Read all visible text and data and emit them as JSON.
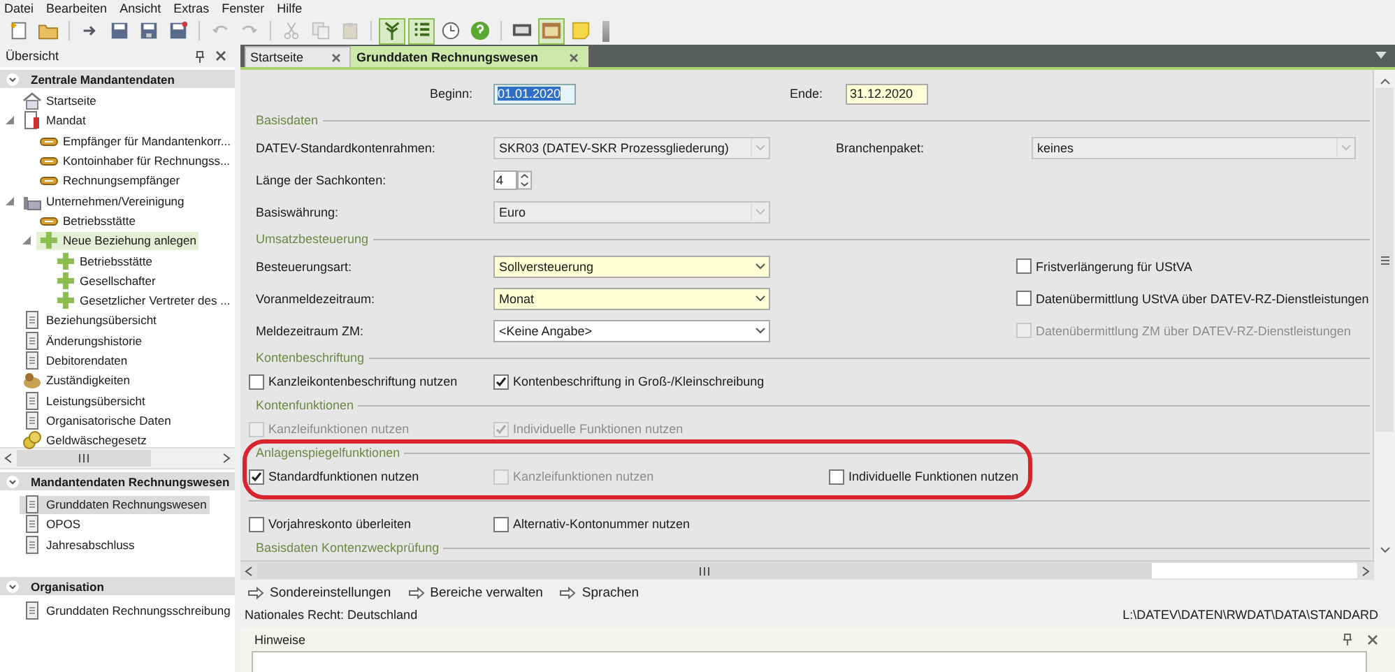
{
  "menu": [
    "Datei",
    "Bearbeiten",
    "Ansicht",
    "Extras",
    "Fenster",
    "Hilfe"
  ],
  "toolbar": [
    [
      {
        "pressed": false,
        "disabled": false
      },
      {
        "pressed": false,
        "disabled": false
      }
    ],
    [
      {
        "pressed": false,
        "disabled": false
      },
      {
        "pressed": false,
        "disabled": false
      },
      {
        "pressed": false,
        "disabled": false
      },
      {
        "pressed": false,
        "disabled": false
      }
    ],
    [
      {
        "pressed": false,
        "disabled": true
      },
      {
        "pressed": false,
        "disabled": true
      }
    ],
    [
      {
        "pressed": false,
        "disabled": true
      },
      {
        "pressed": false,
        "disabled": true
      },
      {
        "pressed": false,
        "disabled": true
      }
    ],
    [
      {
        "pressed": true,
        "disabled": false
      },
      {
        "pressed": true,
        "disabled": false
      },
      {
        "pressed": false,
        "disabled": false
      },
      {
        "pressed": false,
        "disabled": false
      }
    ],
    [
      {
        "pressed": false,
        "disabled": false
      },
      {
        "pressed": true,
        "disabled": false
      },
      {
        "pressed": false,
        "disabled": false
      }
    ]
  ],
  "sidebar": {
    "title": "Übersicht",
    "sections": [
      {
        "title": "Zentrale Mandantendaten",
        "expanded": true,
        "items": [
          {
            "label": "Startseite",
            "kind": "home",
            "selected": false
          },
          {
            "label": "Mandat",
            "kind": "record",
            "selected": false,
            "expanded": true,
            "children": [
              {
                "label": "Empfänger für Mandantenkorr...",
                "kind": "link",
                "selected": false
              },
              {
                "label": "Kontoinhaber für Rechnungss...",
                "kind": "link",
                "selected": false
              },
              {
                "label": "Rechnungsempfänger",
                "kind": "link",
                "selected": false
              }
            ]
          },
          {
            "label": "Unternehmen/Vereinigung",
            "kind": "company",
            "selected": false,
            "expanded": true,
            "children": [
              {
                "label": "Betriebsstätte",
                "kind": "link",
                "selected": false
              },
              {
                "label": "Neue Beziehung anlegen",
                "kind": "plus",
                "selected": true,
                "expanded": true,
                "children": [
                  {
                    "label": "Betriebsstätte",
                    "kind": "plus",
                    "selected": false
                  },
                  {
                    "label": "Gesellschafter",
                    "kind": "plus",
                    "selected": false
                  },
                  {
                    "label": "Gesetzlicher Vertreter des ...",
                    "kind": "plus",
                    "selected": false
                  }
                ]
              }
            ]
          },
          {
            "label": "Beziehungsübersicht",
            "kind": "page",
            "selected": false
          },
          {
            "label": "Änderungshistorie",
            "kind": "page",
            "selected": false
          },
          {
            "label": "Debitorendaten",
            "kind": "page",
            "selected": false
          },
          {
            "label": "Zuständigkeiten",
            "kind": "group",
            "selected": false
          },
          {
            "label": "Leistungsübersicht",
            "kind": "page",
            "selected": false
          },
          {
            "label": "Organisatorische Daten",
            "kind": "page",
            "selected": false
          },
          {
            "label": "Geldwäschegesetz",
            "kind": "coins",
            "selected": false
          }
        ]
      },
      {
        "title": "Mandantendaten Rechnungswesen",
        "expanded": true,
        "items": [
          {
            "label": "Grunddaten Rechnungswesen",
            "kind": "page",
            "selected": true
          },
          {
            "label": "OPOS",
            "kind": "page",
            "selected": false
          },
          {
            "label": "Jahresabschluss",
            "kind": "page",
            "selected": false
          }
        ]
      },
      {
        "title": "Organisation",
        "expanded": true,
        "items": [
          {
            "label": "Grunddaten Rechnungsschreibung",
            "kind": "page",
            "selected": false
          }
        ]
      }
    ]
  },
  "tabs": [
    {
      "label": "Startseite",
      "selected": false
    },
    {
      "label": "Grunddaten Rechnungswesen",
      "selected": true
    }
  ],
  "form": {
    "sections": [
      {
        "rows": [
          {
            "kind": "dates",
            "fields": [
              {
                "label": "Beginn:",
                "value": "01.01.2020",
                "focused": true,
                "required": false
              },
              {
                "label": "Ende:",
                "value": "31.12.2020",
                "focused": false,
                "required": true
              }
            ]
          }
        ]
      },
      {
        "title": "Basisdaten",
        "rows": [
          {
            "kind": "select",
            "label": "DATEV-Standardkontenrahmen:",
            "value": "SKR03 (DATEV-SKR Prozessgliederung)",
            "disabled": true,
            "required": false,
            "side": {
              "label": "Branchenpaket:",
              "value": "keines",
              "disabled": true
            }
          },
          {
            "kind": "spin",
            "label": "Länge der Sachkonten:",
            "value": "4"
          },
          {
            "kind": "select",
            "label": "Basiswährung:",
            "value": "Euro",
            "disabled": true,
            "required": false
          }
        ]
      },
      {
        "title": "Umsatzbesteuerung",
        "rows": [
          {
            "kind": "select",
            "label": "Besteuerungsart:",
            "value": "Sollversteuerung",
            "disabled": false,
            "required": true,
            "check": {
              "label": "Fristverlängerung für UStVA",
              "checked": false,
              "disabled": false
            }
          },
          {
            "kind": "select",
            "label": "Voranmeldezeitraum:",
            "value": "Monat",
            "disabled": false,
            "required": true,
            "check": {
              "label": "Datenübermittlung UStVA über DATEV-RZ-Dienstleistungen",
              "checked": false,
              "disabled": false
            }
          },
          {
            "kind": "select",
            "label": "Meldezeitraum ZM:",
            "value": "<Keine Angabe>",
            "disabled": false,
            "required": false,
            "check": {
              "label": "Datenübermittlung ZM über DATEV-RZ-Dienstleistungen",
              "checked": false,
              "disabled": true
            }
          }
        ]
      },
      {
        "title": "Kontenbeschriftung",
        "rows": [
          {
            "kind": "checks",
            "items": [
              {
                "label": "Kanzleikontenbeschriftung nutzen",
                "checked": false,
                "disabled": false
              },
              {
                "label": "Kontenbeschriftung in Groß-/Kleinschreibung",
                "checked": true,
                "disabled": false
              }
            ]
          }
        ]
      },
      {
        "title": "Kontenfunktionen",
        "rows": [
          {
            "kind": "checks",
            "items": [
              {
                "label": "Kanzleifunktionen nutzen",
                "checked": false,
                "disabled": true
              },
              {
                "label": "Individuelle Funktionen nutzen",
                "checked": true,
                "disabled": true
              }
            ]
          }
        ]
      },
      {
        "title": "Anlagenspiegelfunktionen",
        "rows": [
          {
            "kind": "checks",
            "items": [
              {
                "label": "Standardfunktionen nutzen",
                "checked": true,
                "disabled": false
              },
              {
                "label": "Kanzleifunktionen nutzen",
                "checked": false,
                "disabled": true
              },
              {
                "label": "Individuelle Funktionen nutzen",
                "checked": false,
                "disabled": false
              }
            ]
          }
        ]
      },
      {
        "rows": [
          {
            "kind": "checks",
            "items": [
              {
                "label": "Vorjahreskonto überleiten",
                "checked": false,
                "disabled": false
              },
              {
                "label": "Alternativ-Kontonummer nutzen",
                "checked": false,
                "disabled": false
              }
            ]
          }
        ]
      },
      {
        "title": "Basisdaten Kontenzweckprüfung"
      }
    ]
  },
  "links": [
    "Sondereinstellungen",
    "Bereiche verwalten",
    "Sprachen"
  ],
  "status": {
    "left": "Nationales Recht: Deutschland",
    "right": "L:\\DATEV\\DATEN\\RWDAT\\DATA\\STANDARD"
  },
  "notes_panel": {
    "title": "Hinweise"
  }
}
